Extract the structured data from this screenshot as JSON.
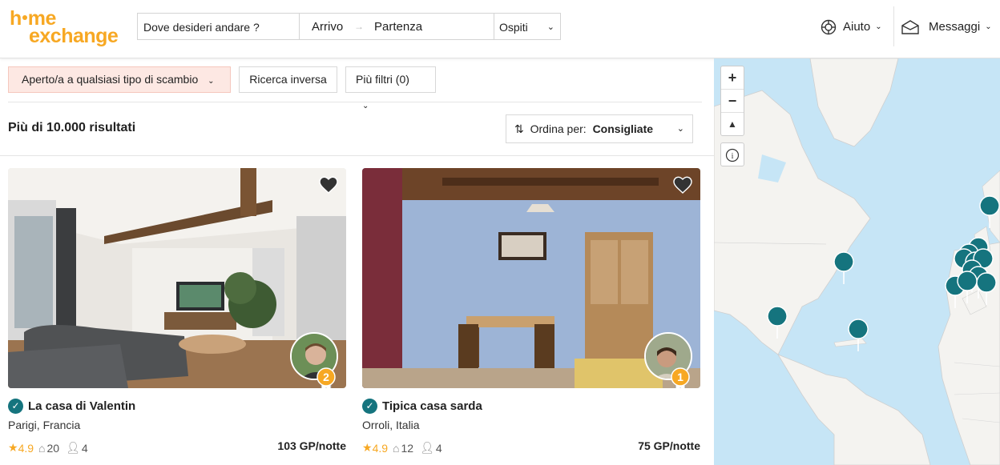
{
  "header": {
    "logo_line1_a": "h",
    "logo_line1_b": "me",
    "logo_line2": "exchange",
    "search_placeholder": "Dove desideri andare ?",
    "arrival": "Arrivo",
    "departure": "Partenza",
    "guests": "Ospiti",
    "help": "Aiuto",
    "messages": "Messaggi",
    "accent_color": "#f7a823"
  },
  "filters": {
    "exchange_type": "Aperto/a a qualsiasi tipo di scambio",
    "reverse_search": "Ricerca inversa",
    "more_filters": "Più filtri (0)"
  },
  "results": {
    "count_text": "Più di 10.000 risultati",
    "sort_label": "Ordina per:",
    "sort_value": "Consigliate"
  },
  "listings": [
    {
      "title": "La casa di Valentin",
      "location": "Parigi, Francia",
      "rating": "4.9",
      "guests_capacity_a": "20",
      "beds": "4",
      "price": "103 GP/notte",
      "rank": "2"
    },
    {
      "title": "Tipica casa sarda",
      "location": "Orroli, Italia",
      "rating": "4.9",
      "guests_capacity_a": "12",
      "beds": "4",
      "price": "75 GP/notte",
      "rank": "1"
    }
  ],
  "map": {
    "zoom_in": "+",
    "zoom_out": "−",
    "compass": "▲",
    "info": "i",
    "pin_color": "#15747e"
  }
}
